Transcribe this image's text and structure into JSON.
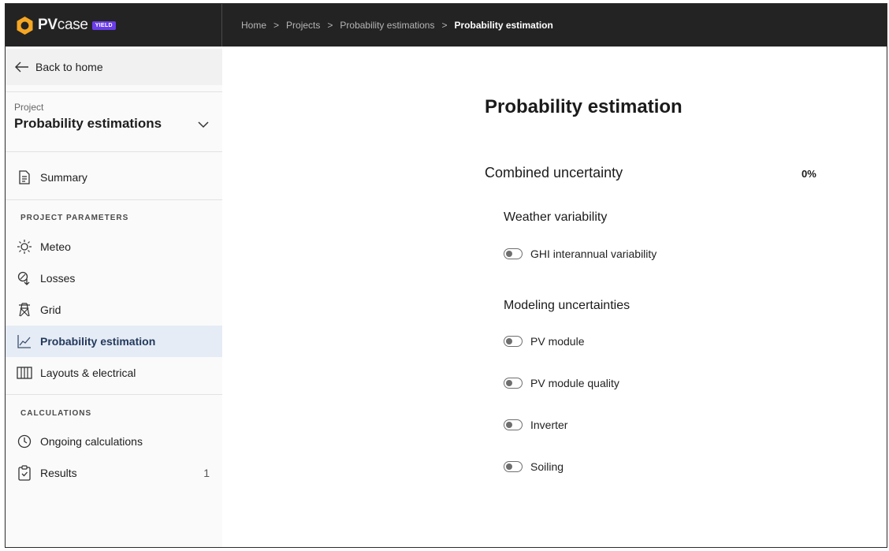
{
  "brand": {
    "name_bold": "PV",
    "name_light": "case",
    "badge": "YIELD"
  },
  "breadcrumb": {
    "items": [
      "Home",
      "Projects",
      "Probability estimations"
    ],
    "current": "Probability estimation",
    "separator": ">"
  },
  "sidebar": {
    "back_label": "Back to home",
    "project_label": "Project",
    "project_name": "Probability estimations",
    "summary_label": "Summary",
    "section_parameters": "PROJECT PARAMETERS",
    "items": {
      "meteo": "Meteo",
      "losses": "Losses",
      "grid": "Grid",
      "probability": "Probability estimation",
      "layouts": "Layouts & electrical"
    },
    "section_calculations": "CALCULATIONS",
    "ongoing_label": "Ongoing calculations",
    "results_label": "Results",
    "results_count": "1"
  },
  "main": {
    "title": "Probability estimation",
    "combined_label": "Combined uncertainty",
    "combined_value": "0%",
    "weather_title": "Weather variability",
    "weather_items": [
      "GHI interannual variability"
    ],
    "modeling_title": "Modeling uncertainties",
    "modeling_items": [
      "PV module",
      "PV module quality",
      "Inverter",
      "Soiling"
    ]
  },
  "colors": {
    "topbar": "#232323",
    "logo": "#f5a623",
    "badge": "#6a3de8",
    "active_bg": "#e6ecf5"
  }
}
